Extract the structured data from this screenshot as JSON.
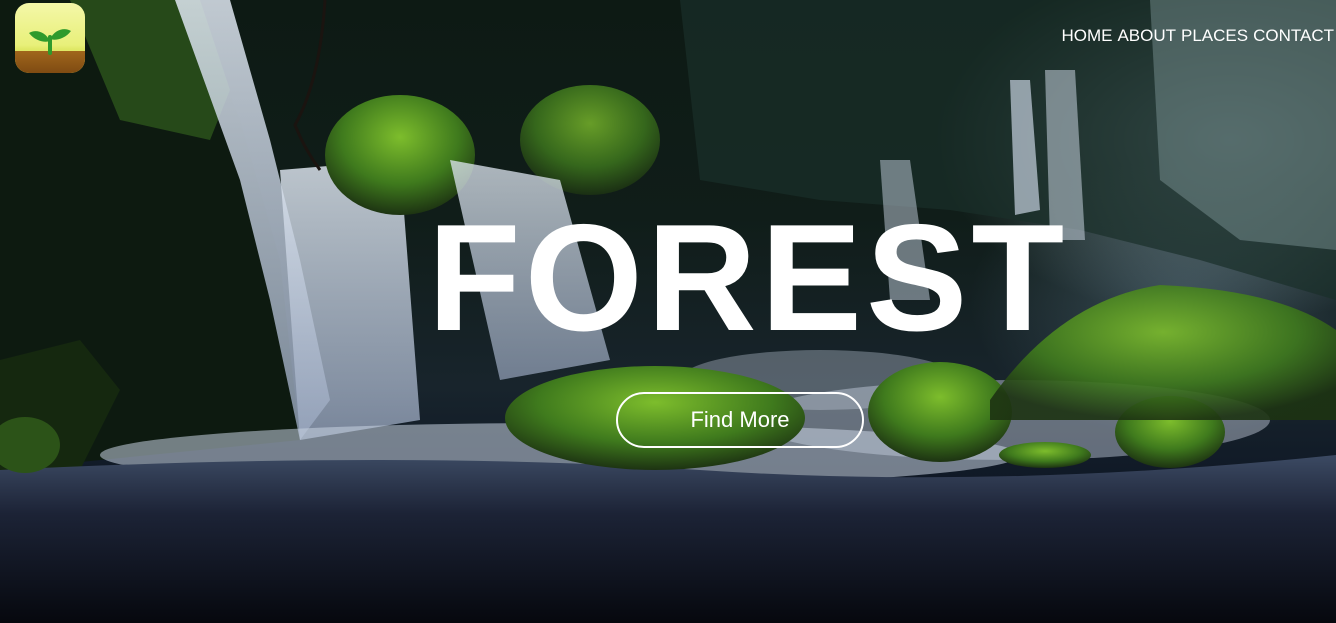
{
  "nav": {
    "items": [
      {
        "label": "HOME"
      },
      {
        "label": "ABOUT"
      },
      {
        "label": "PLACES"
      },
      {
        "label": "CONTACT"
      }
    ]
  },
  "hero": {
    "title": "FOREST",
    "cta_label": "Find More"
  },
  "logo": {
    "icon": "sprout-icon",
    "colors": {
      "sky": "#eef38a",
      "soil": "#8a5316",
      "leaf": "#2f9a2c"
    }
  },
  "colors": {
    "text": "#ffffff",
    "moss": "#4f8f25",
    "water": "#c9d3e2"
  }
}
